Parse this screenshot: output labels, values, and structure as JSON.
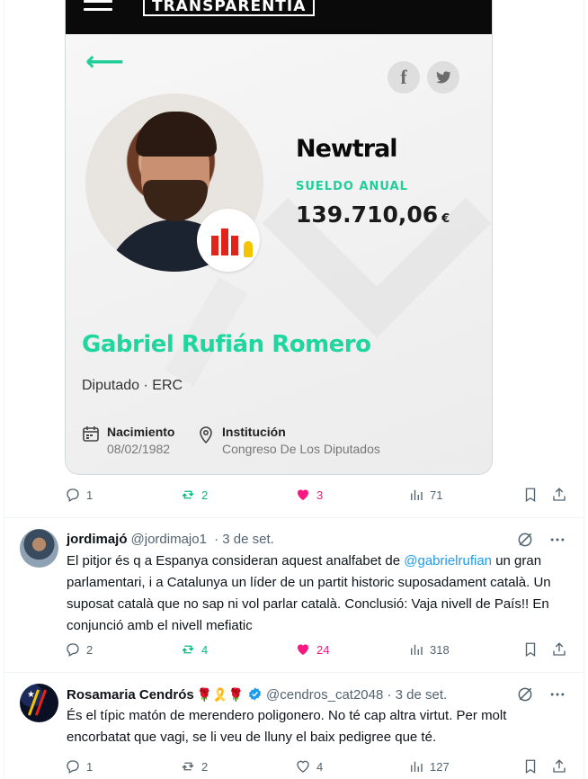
{
  "media_card": {
    "logo": "TRANSPARENTIA",
    "outlet": "Newtral",
    "salary_label": "SUELDO ANUAL",
    "salary_value": "139.710,06",
    "salary_currency": "€",
    "person_name": "Gabriel Rufián Romero",
    "role": "Diputado · ERC",
    "birth_label": "Nacimiento",
    "birth_value": "08/02/1982",
    "institution_label": "Institución",
    "institution_value": "Congreso De Los Diputados",
    "colors": {
      "accent": "#1fd79e",
      "header": "#0a0a0a"
    }
  },
  "main_post_actions": {
    "replies": "1",
    "reposts": "2",
    "likes": "3",
    "views": "71"
  },
  "replies": [
    {
      "name": "jordimajó",
      "handle": "@jordimajo1",
      "time": "3 de set.",
      "text_before_mention": "El pitjor és q a Espanya consideran aquest analfabet de ",
      "mention": "@gabrielrufian",
      "text_after_mention": " un gran parlamentari, i a Catalunya un líder de un partit historic suposadament català. Un suposat català que no sap ni vol parlar català. Conclusió: Vaja nivell de País!! En conjunció amb el nivell mefiatic",
      "actions": {
        "replies": "2",
        "reposts": "4",
        "likes": "24",
        "views": "318"
      }
    },
    {
      "name": "Rosamaria Cendrós",
      "name_emojis": "🌹🎗️🌹",
      "handle": "@cendros_cat2048",
      "time": "3 de set.",
      "text": "És el típic matón de merendero poligonero. No té cap altra virtut. Per molt encorbatat que vagi, se li veu de lluny el baix pedigree que té.",
      "actions": {
        "replies": "1",
        "reposts": "2",
        "likes": "4",
        "views": "127"
      }
    }
  ],
  "separator": " · "
}
